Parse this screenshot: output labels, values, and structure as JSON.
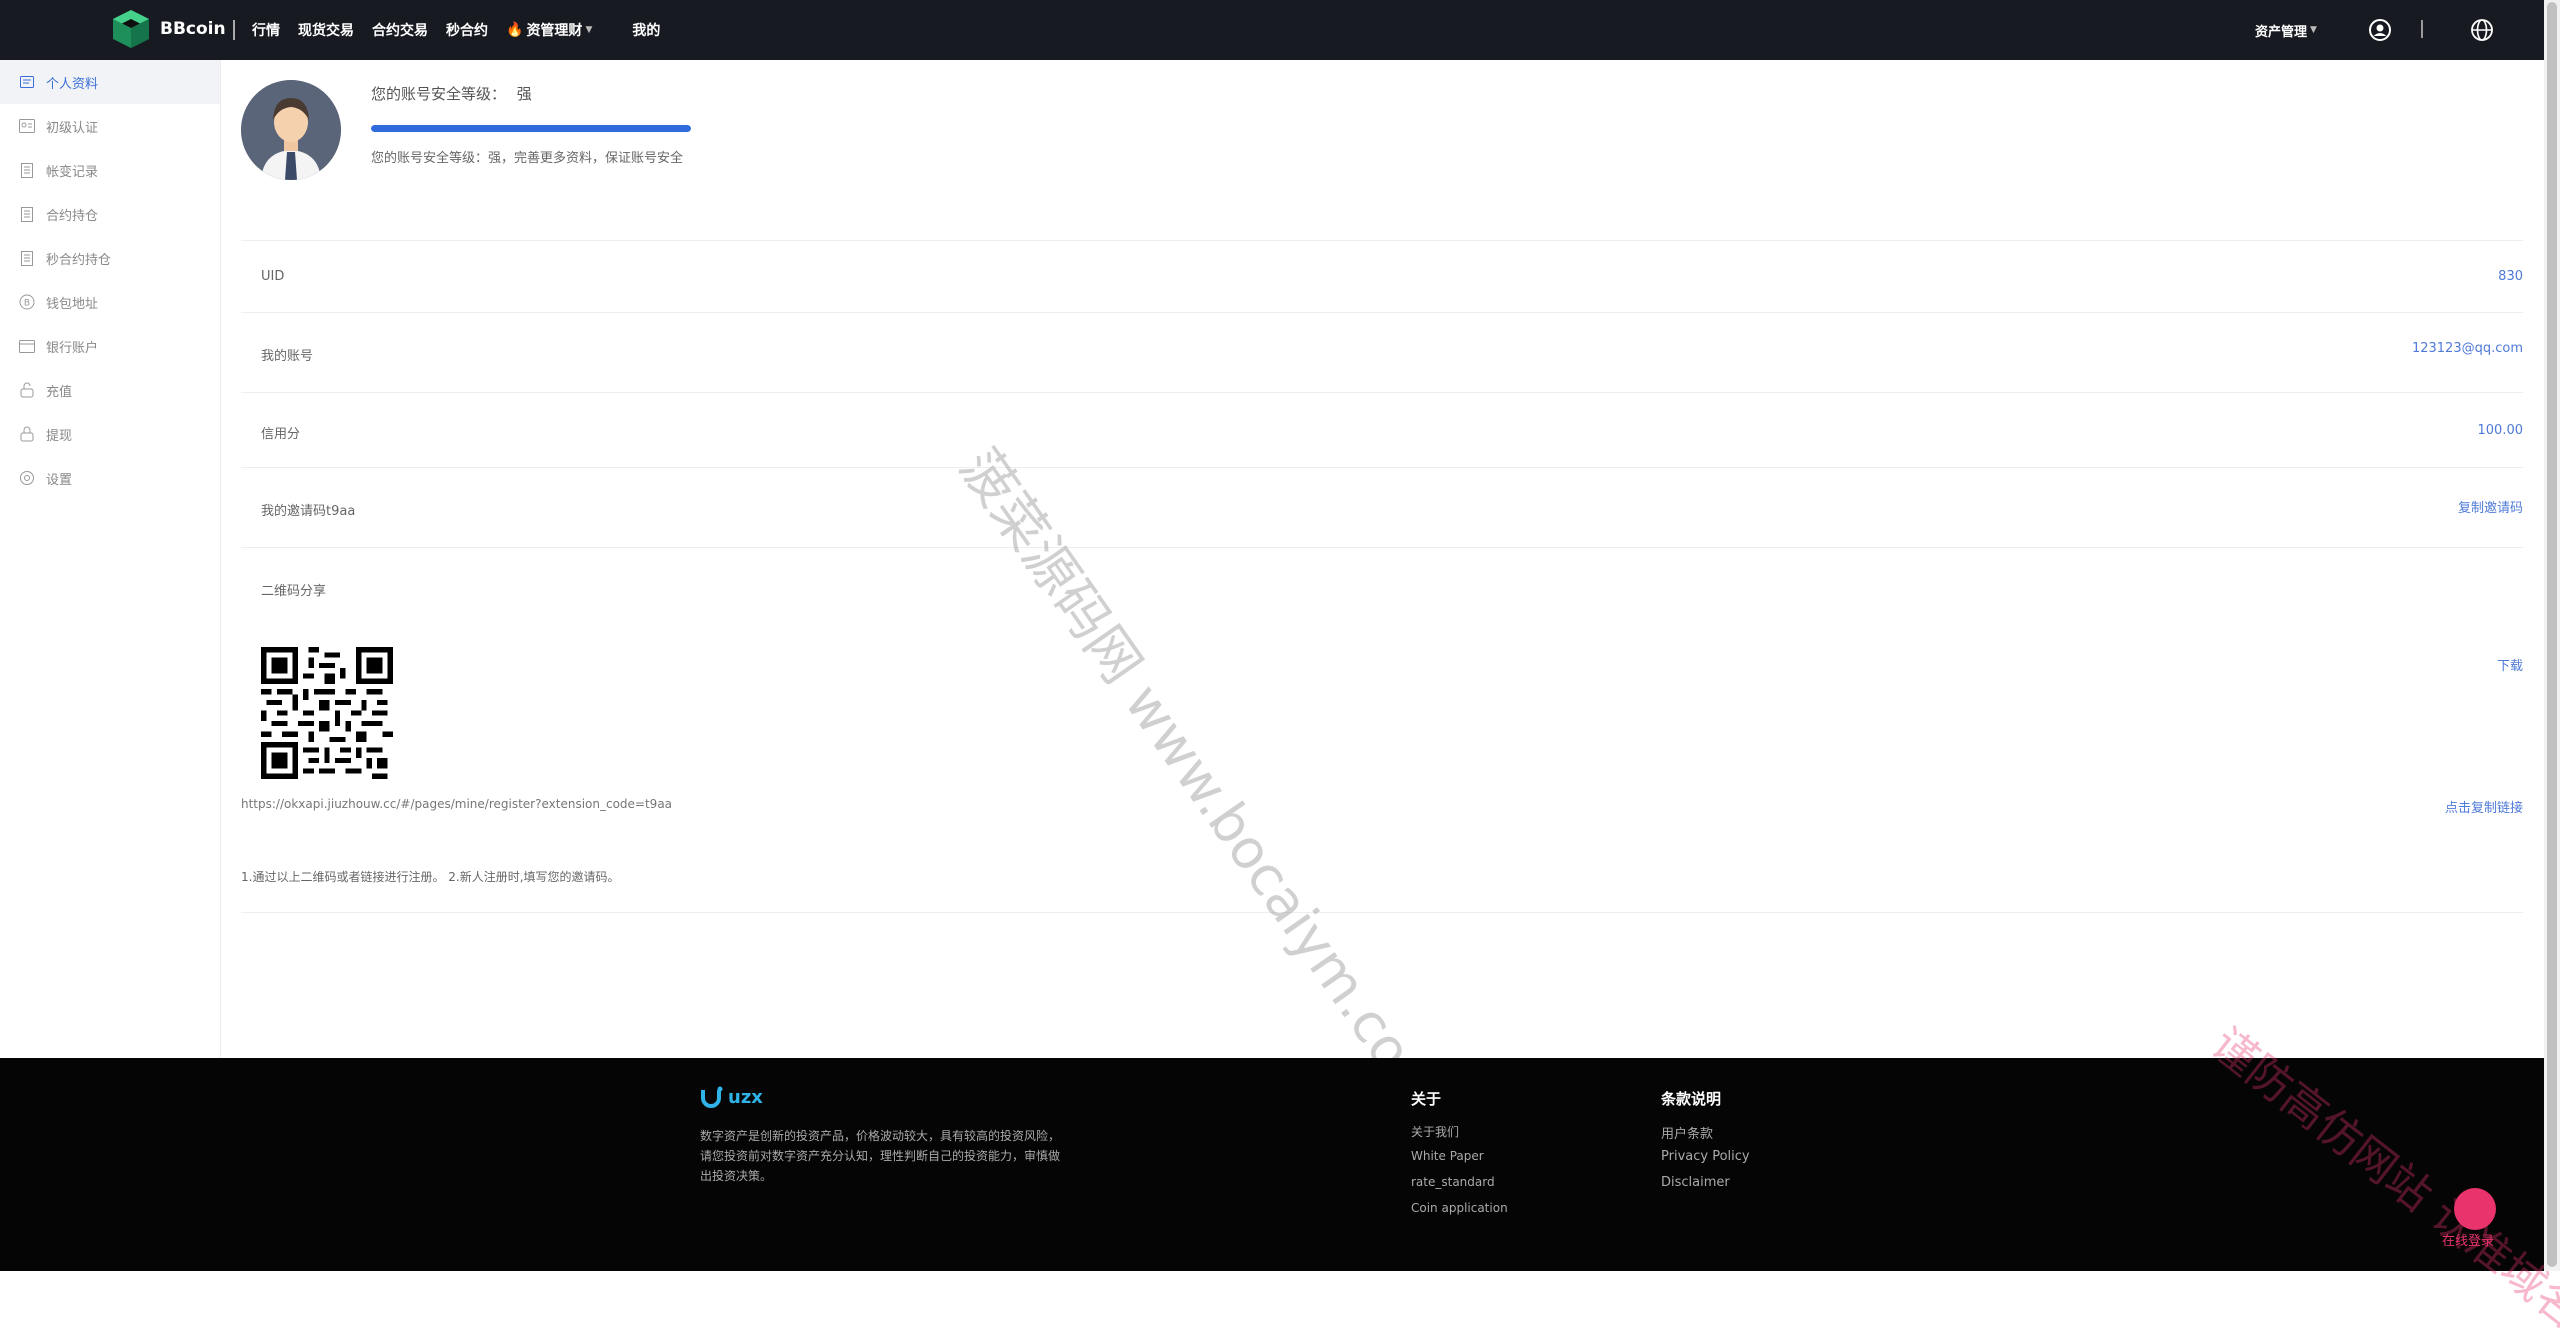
{
  "header": {
    "brand": "BBcoin",
    "nav": [
      {
        "label": "行情"
      },
      {
        "label": "现货交易"
      },
      {
        "label": "合约交易"
      },
      {
        "label": "秒合约"
      },
      {
        "label": "资管理财"
      },
      {
        "label": "我的"
      }
    ],
    "asset_management": "资产管理",
    "icons": {
      "user": "user-circle-icon",
      "language": "globe-icon",
      "hot": "fire-icon"
    }
  },
  "sidebar": {
    "items": [
      {
        "label": "个人资料",
        "icon": "profile-card-icon",
        "active": true
      },
      {
        "label": "初级认证",
        "icon": "id-card-icon",
        "active": false
      },
      {
        "label": "帐变记录",
        "icon": "document-icon",
        "active": false
      },
      {
        "label": "合约持仓",
        "icon": "document-icon",
        "active": false
      },
      {
        "label": "秒合约持仓",
        "icon": "document-icon",
        "active": false
      },
      {
        "label": "钱包地址",
        "icon": "bitcoin-icon",
        "active": false
      },
      {
        "label": "银行账户",
        "icon": "bank-card-icon",
        "active": false
      },
      {
        "label": "充值",
        "icon": "lock-icon",
        "active": false
      },
      {
        "label": "提现",
        "icon": "lock-icon",
        "active": false
      },
      {
        "label": "设置",
        "icon": "gear-icon",
        "active": false
      }
    ]
  },
  "security": {
    "title": "您的账号安全等级：",
    "level": "强",
    "progress_percent": 100,
    "description": "您的账号安全等级：强，完善更多资料，保证账号安全"
  },
  "profile": {
    "uid_label": "UID",
    "uid_value": "830",
    "account_label": "我的账号",
    "account_value": "123123@qq.com",
    "credit_label": "信用分",
    "credit_value": "100.00",
    "invite_label": "我的邀请码t9aa",
    "invite_copy": "复制邀请码",
    "qr_label": "二维码分享",
    "qr_download": "下载",
    "register_link": "https://okxapi.jiuzhouw.cc/#/pages/mine/register?extension_code=t9aa",
    "link_copy": "点击复制链接",
    "notes": "1.通过以上二维码或者链接进行注册。   2.新人注册时,填写您的邀请码。"
  },
  "footer": {
    "brand": "uzx",
    "description": "数字资产是创新的投资产品，价格波动较大，具有较高的投资风险，请您投资前对数字资产充分认知，理性判断自己的投资能力，审慎做出投资决策。",
    "columns": [
      {
        "title": "关于",
        "items": [
          "关于我们",
          "White Paper",
          "rate_standard",
          "Coin application"
        ]
      },
      {
        "title": "条款说明",
        "items": [
          "用户条款",
          "Privacy Policy",
          "Disclaimer"
        ]
      }
    ],
    "online_login": "在线登录"
  },
  "watermarks": {
    "main": "菠菜源码网 www.bocaiym.com",
    "corner": "谨防高仿网站 认准域名"
  },
  "colors": {
    "topbar_bg": "#171a21",
    "accent_blue": "#2f6bdc",
    "link_blue": "#4f7ad8",
    "footer_bg": "#050505",
    "brand_green": "#2bbf7a"
  }
}
